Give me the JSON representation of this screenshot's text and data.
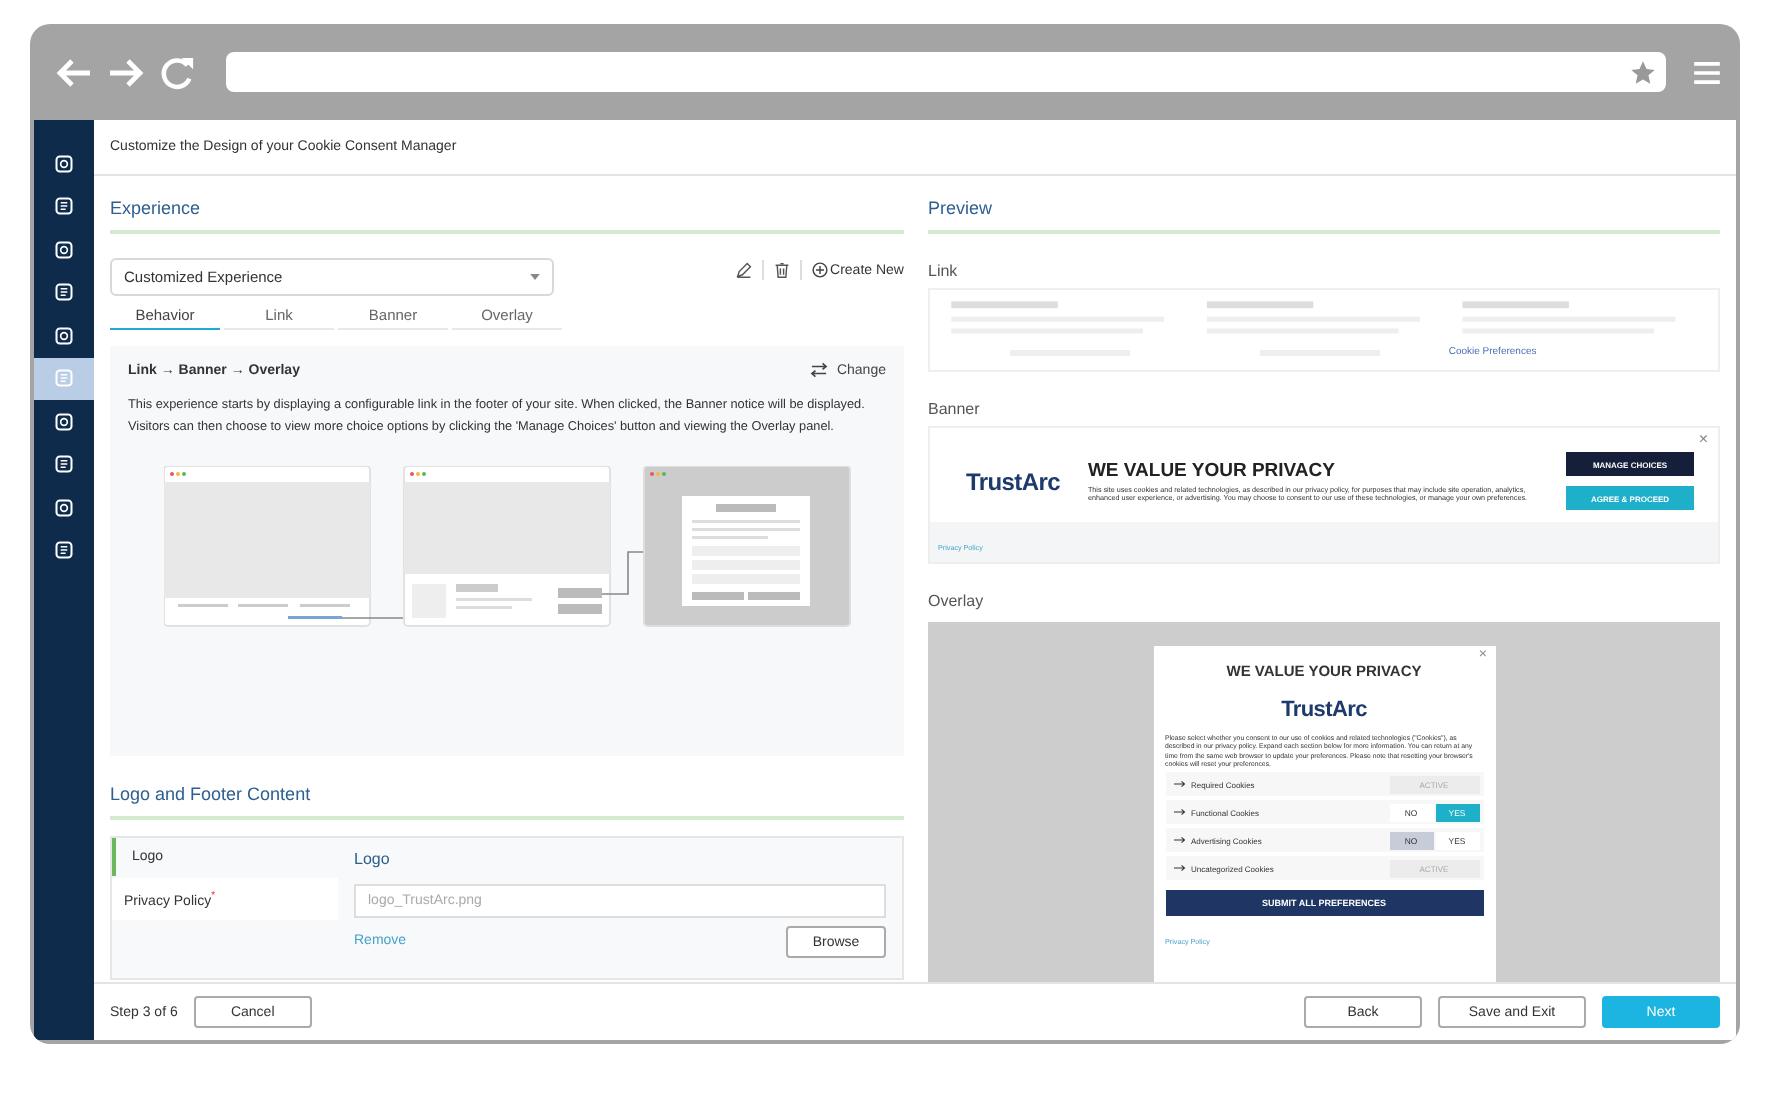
{
  "header": {
    "title": "Customize the Design of your Cookie Consent Manager"
  },
  "sidebar": {
    "items": [
      {
        "selected": false
      },
      {
        "selected": false
      },
      {
        "selected": false
      },
      {
        "selected": false
      },
      {
        "selected": false
      },
      {
        "selected": true
      },
      {
        "selected": false
      },
      {
        "selected": false
      },
      {
        "selected": false
      },
      {
        "selected": false
      }
    ]
  },
  "experience": {
    "heading": "Experience",
    "dropdown": {
      "value": "Customized Experience"
    },
    "create_new": "Create New",
    "tabs": [
      {
        "label": "Behavior",
        "selected": true
      },
      {
        "label": "Link",
        "selected": false
      },
      {
        "label": "Banner",
        "selected": false
      },
      {
        "label": "Overlay",
        "selected": false
      }
    ],
    "flow": {
      "title": "Link → Banner → Overlay",
      "change": "Change",
      "description": "This experience starts by displaying a configurable link in the footer of your site. When clicked, the Banner notice will be displayed. Visitors can then choose to view more choice options by clicking the 'Manage Choices' button and viewing the Overlay panel."
    }
  },
  "logo_footer": {
    "heading": "Logo and Footer Content",
    "required_mark": "*",
    "nav": [
      {
        "label": "Logo",
        "selected": true,
        "required": false
      },
      {
        "label": "Privacy Policy",
        "selected": false,
        "required": true
      }
    ],
    "logo": {
      "heading": "Logo",
      "placeholder": "logo_TrustArc.png",
      "remove": "Remove",
      "browse": "Browse"
    }
  },
  "preview": {
    "heading": "Preview",
    "link": {
      "label": "Link",
      "link_text": "Cookie Preferences"
    },
    "banner": {
      "label": "Banner",
      "close": "×",
      "logo": "TrustArc",
      "title": "WE VALUE YOUR PRIVACY",
      "text": "This site uses cookies and related technologies, as described in our privacy policy, for purposes that may include site operation, analytics, enhanced user experience, or advertising. You may choose to consent to our use of these technologies, or manage your own preferences.",
      "buttons": [
        {
          "label": "MANAGE CHOICES",
          "kind": "dark"
        },
        {
          "label": "AGREE & PROCEED",
          "kind": "teal"
        }
      ],
      "footer_link": "Privacy Policy"
    },
    "overlay": {
      "label": "Overlay",
      "close": "×",
      "title": "WE VALUE YOUR PRIVACY",
      "logo": "TrustArc",
      "text": "Please select whether you consent to our use of cookies and related technologies (\"Cookies\"), as described in our privacy policy. Expand each section below for more information. You can return at any time from the same web browser to update your preferences. Please note that resetting your browser's cookies will reset your preferences.",
      "categories": [
        {
          "name": "Required Cookies",
          "kind": "status",
          "status": "ACTIVE"
        },
        {
          "name": "Functional Cookies",
          "kind": "toggle",
          "options": [
            {
              "label": "NO",
              "selected": false
            },
            {
              "label": "YES",
              "selected": true
            }
          ]
        },
        {
          "name": "Advertising Cookies",
          "kind": "toggle",
          "options": [
            {
              "label": "NO",
              "selected": true
            },
            {
              "label": "YES",
              "selected": false
            }
          ]
        },
        {
          "name": "Uncategorized Cookies",
          "kind": "status",
          "status": "ACTIVE"
        }
      ],
      "submit": "SUBMIT ALL PREFERENCES",
      "footer_link": "Privacy Policy"
    }
  },
  "footer": {
    "step": "Step 3 of 6",
    "cancel": "Cancel",
    "back": "Back",
    "save_exit": "Save and Exit",
    "next": "Next"
  }
}
